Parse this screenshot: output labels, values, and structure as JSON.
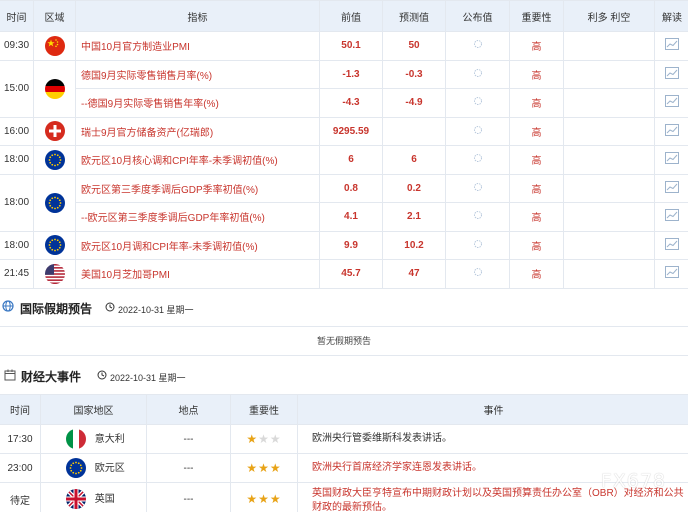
{
  "econ": {
    "headers": [
      "时间",
      "区域",
      "指标",
      "前值",
      "预测值",
      "公布值",
      "重要性",
      "利多 利空",
      "解读"
    ],
    "rows": [
      {
        "time": "09:30",
        "flag": "china-flag",
        "indicator": "中国10月官方制造业PMI",
        "prev": "50.1",
        "forecast": "50",
        "actual": "",
        "importance": "高"
      },
      {
        "time": "15:00",
        "flag": "germany-flag",
        "indicator": "德国9月实际零售销售月率(%)",
        "prev": "-1.3",
        "forecast": "-0.3",
        "actual": "",
        "importance": "高"
      },
      {
        "time": "",
        "flag": "",
        "indicator": "--德国9月实际零售销售年率(%)",
        "prev": "-4.3",
        "forecast": "-4.9",
        "actual": "",
        "importance": "高"
      },
      {
        "time": "16:00",
        "flag": "switzerland-flag",
        "indicator": "瑞士9月官方储备资产(亿瑞郎)",
        "prev": "9295.59",
        "forecast": "",
        "actual": "",
        "importance": "高"
      },
      {
        "time": "18:00",
        "flag": "eu-flag",
        "indicator": "欧元区10月核心调和CPI年率-未季调初值(%)",
        "prev": "6",
        "forecast": "6",
        "actual": "",
        "importance": "高"
      },
      {
        "time": "18:00",
        "flag": "eu-flag",
        "indicator": "欧元区第三季度季调后GDP季率初值(%)",
        "prev": "0.8",
        "forecast": "0.2",
        "actual": "",
        "importance": "高"
      },
      {
        "time": "",
        "flag": "",
        "indicator": "--欧元区第三季度季调后GDP年率初值(%)",
        "prev": "4.1",
        "forecast": "2.1",
        "actual": "",
        "importance": "高"
      },
      {
        "time": "18:00",
        "flag": "eu-flag",
        "indicator": "欧元区10月调和CPI年率-未季调初值(%)",
        "prev": "9.9",
        "forecast": "10.2",
        "actual": "",
        "importance": "高"
      },
      {
        "time": "21:45",
        "flag": "usa-flag",
        "indicator": "美国10月芝加哥PMI",
        "prev": "45.7",
        "forecast": "47",
        "actual": "",
        "importance": "高"
      }
    ]
  },
  "holiday": {
    "title": "国际假期预告",
    "date": "2022-10-31 星期一",
    "empty_text": "暂无假期预告"
  },
  "events_section": {
    "title": "财经大事件",
    "date": "2022-10-31 星期一"
  },
  "events": {
    "headers": [
      "时间",
      "国家地区",
      "地点",
      "重要性",
      "事件"
    ],
    "rows": [
      {
        "time": "17:30",
        "flag": "italy-flag",
        "country": "意大利",
        "place": "---",
        "stars": 1,
        "event": "欧洲央行管委维斯科发表讲话。"
      },
      {
        "time": "23:00",
        "flag": "eu-flag",
        "country": "欧元区",
        "place": "---",
        "stars": 3,
        "event": "欧洲央行首席经济学家连恩发表讲话。"
      },
      {
        "time": "待定",
        "flag": "uk-flag",
        "country": "英国",
        "place": "---",
        "stars": 3,
        "event": "英国财政大臣亨特宣布中期财政计划以及英国预算责任办公室（OBR）对经济和公共财政的最新预估。"
      }
    ]
  },
  "watermark": "FX678",
  "colors": {
    "accent_red": "#c8352d",
    "header_bg": "#e9f0f9",
    "star_gold": "#e8a317"
  }
}
